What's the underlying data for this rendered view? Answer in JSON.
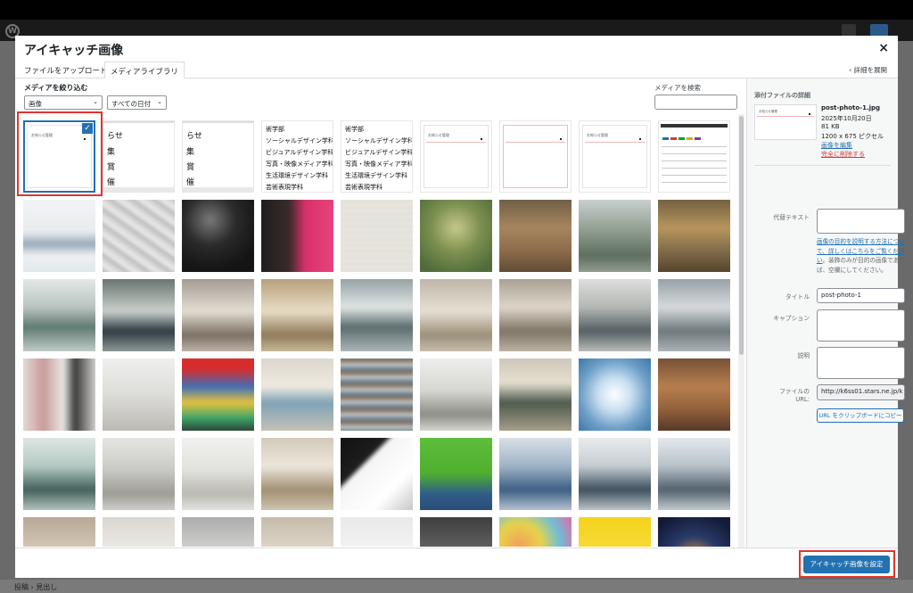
{
  "modal": {
    "title": "アイキャッチ画像",
    "close_glyph": "×",
    "tabs": [
      "ファイルをアップロード",
      "メディアライブラリ"
    ],
    "expand_link": "‹ 詳細を展開"
  },
  "filters": {
    "label": "メディアを絞り込む",
    "type_value": "画像",
    "date_value": "すべての日付",
    "search_label": "メディアを検索",
    "search_placeholder": ""
  },
  "grid": {
    "text_tiles": [
      [
        "らせ",
        "集",
        "賞",
        "催"
      ],
      [
        "らせ",
        "集",
        "賞",
        "催"
      ],
      [
        "術学部",
        "ソーシャルデザイン学科",
        "ビジュアルデザイン学科",
        "写真・映像メディア学科",
        "生活環境デザイン学科",
        "芸術表現学科"
      ],
      [
        "術学部",
        "ソーシャルデザイン学科",
        "ビジュアルデザイン学科",
        "写真・映像メディア学科",
        "生活環境デザイン学科",
        "芸術表現学科"
      ]
    ],
    "check_glyph": "✓",
    "selected_index": 0
  },
  "attachment": {
    "heading": "添付ファイルの詳細",
    "filename": "post-photo-1.jpg",
    "date": "2025年10月20日",
    "size": "81 KB",
    "dimensions": "1200 x 675 ピクセル",
    "edit_link": "画像を編集",
    "delete_link": "完全に削除する",
    "alt_label": "代替テキスト",
    "alt_value": "",
    "alt_help_link": "画像の目的を説明する方法について、詳しくはこちらをご覧ください",
    "alt_help_rest": "。装飾のみが目的の画像であれば、空欄にしてください。",
    "title_label": "タイトル",
    "title_value": "post-photo-1",
    "caption_label": "キャプション",
    "caption_value": "",
    "desc_label": "説明",
    "desc_value": "",
    "url_label": "ファイルの URL:",
    "url_value": "http://k6ss01.stars.ne.jp/k",
    "copy_button": "URL をクリップボードにコピー"
  },
  "footer": {
    "primary_button": "アイキャッチ画像を設定"
  },
  "background": {
    "bottom_breadcrumb": "投稿 › 見出し"
  }
}
